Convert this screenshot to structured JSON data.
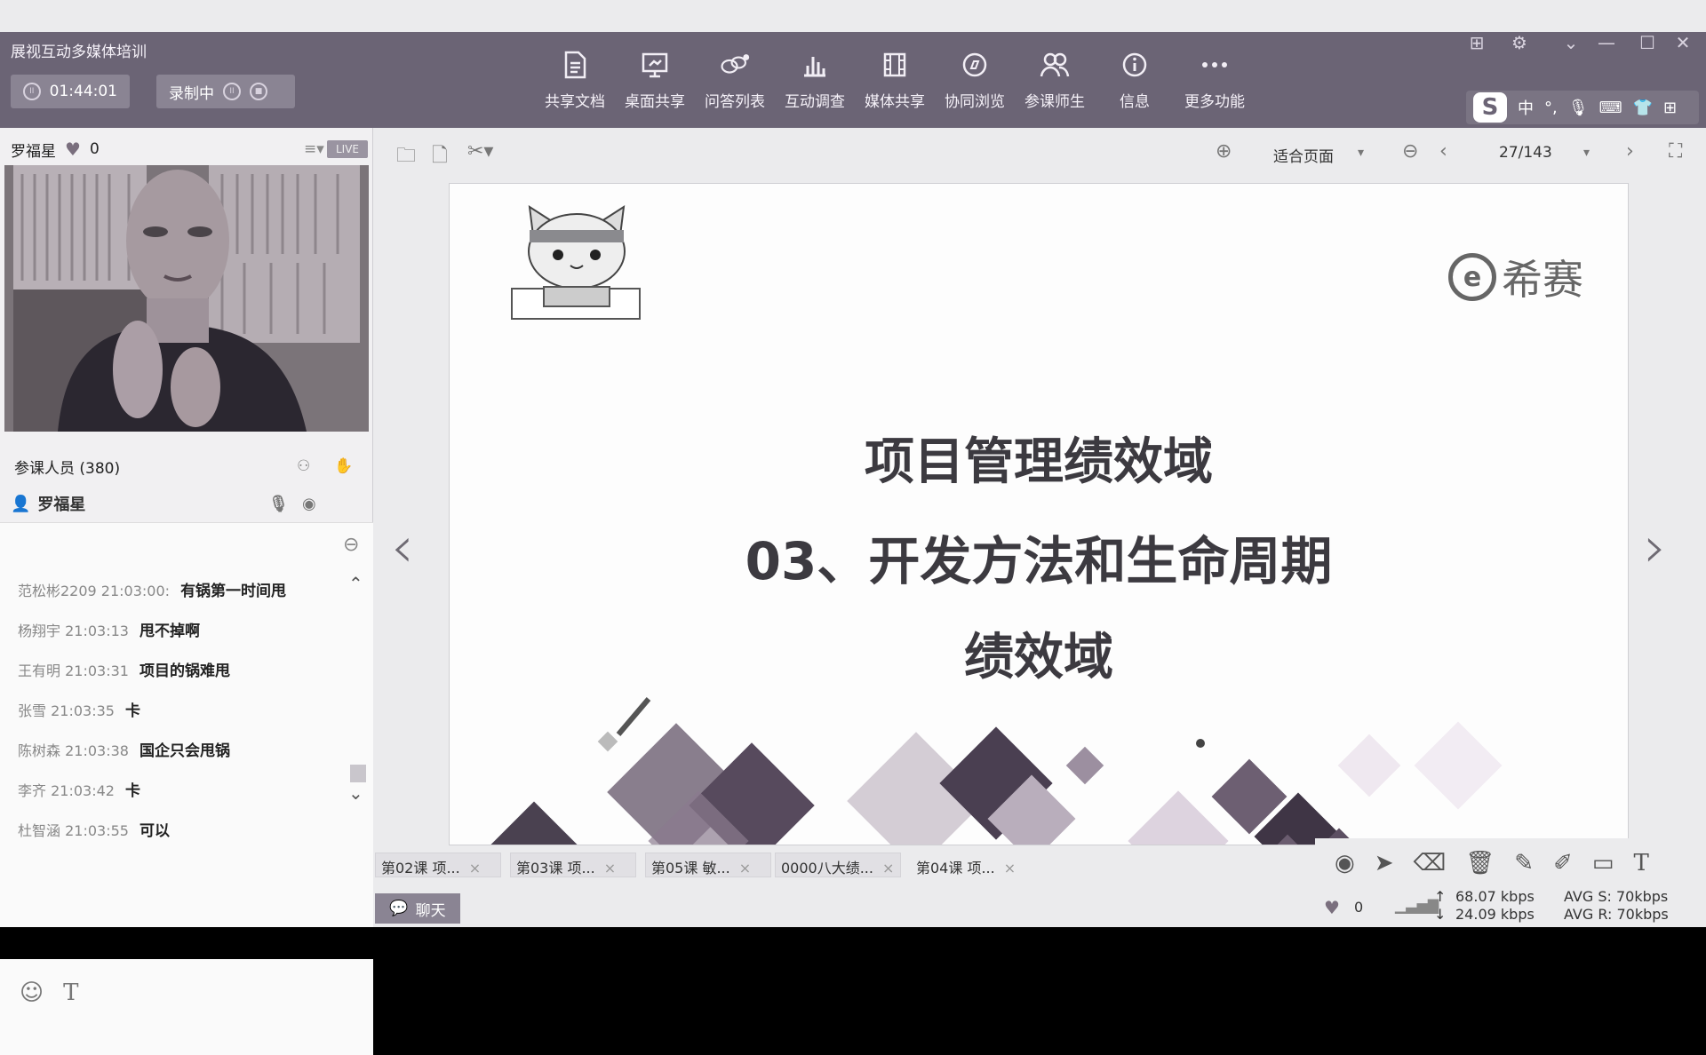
{
  "app": {
    "title": "展视互动多媒体培训"
  },
  "session": {
    "timer": "01:44:01",
    "record_label": "录制中"
  },
  "toolbar": {
    "items": [
      {
        "label": "共享文档",
        "icon": "document-icon"
      },
      {
        "label": "桌面共享",
        "icon": "desktop-share-icon"
      },
      {
        "label": "问答列表",
        "icon": "qa-icon"
      },
      {
        "label": "互动调查",
        "icon": "poll-icon"
      },
      {
        "label": "媒体共享",
        "icon": "media-icon"
      },
      {
        "label": "协同浏览",
        "icon": "compass-icon"
      },
      {
        "label": "参课师生",
        "icon": "people-icon"
      },
      {
        "label": "信息",
        "icon": "info-icon"
      },
      {
        "label": "更多功能",
        "icon": "more-icon"
      }
    ]
  },
  "ime": {
    "brand": "S",
    "lang": "中"
  },
  "presenter": {
    "name": "罗福星",
    "likes": "0",
    "live_badge": "LIVE"
  },
  "participants": {
    "label": "参课人员 (380)",
    "host_name": "罗福星"
  },
  "chat": {
    "messages": [
      {
        "who": "范松彬2209 21:03:00:",
        "text": "有锅第一时间甩"
      },
      {
        "who": "杨翔宇 21:03:13",
        "text": "甩不掉啊"
      },
      {
        "who": "王有明 21:03:31",
        "text": "项目的锅难甩"
      },
      {
        "who": "张雪 21:03:35",
        "text": "卡"
      },
      {
        "who": "陈树森 21:03:38",
        "text": "国企只会甩锅"
      },
      {
        "who": "李齐 21:03:42",
        "text": "卡"
      },
      {
        "who": "杜智涵 21:03:55",
        "text": "可以"
      }
    ],
    "chat_button": "聊天"
  },
  "doc": {
    "zoom": "适合页面",
    "page": "27/143",
    "tabs": [
      {
        "label": "第02课 项..."
      },
      {
        "label": "第03课 项..."
      },
      {
        "label": "第05课 敏..."
      },
      {
        "label": "0000八大绩..."
      },
      {
        "label": "第04课 项..."
      }
    ]
  },
  "slide": {
    "logo_text": "希赛",
    "line1": "项目管理绩效域",
    "line2": "03、开发方法和生命周期",
    "line3": "绩效域"
  },
  "status": {
    "likes": "0",
    "up_rate": "68.07 kbps",
    "down_rate": "24.09 kbps",
    "avg_s": "AVG S: 70kbps",
    "avg_r": "AVG R: 70kbps"
  },
  "colors": {
    "accent": "#6b6475",
    "slide_text": "#3c3a40"
  }
}
